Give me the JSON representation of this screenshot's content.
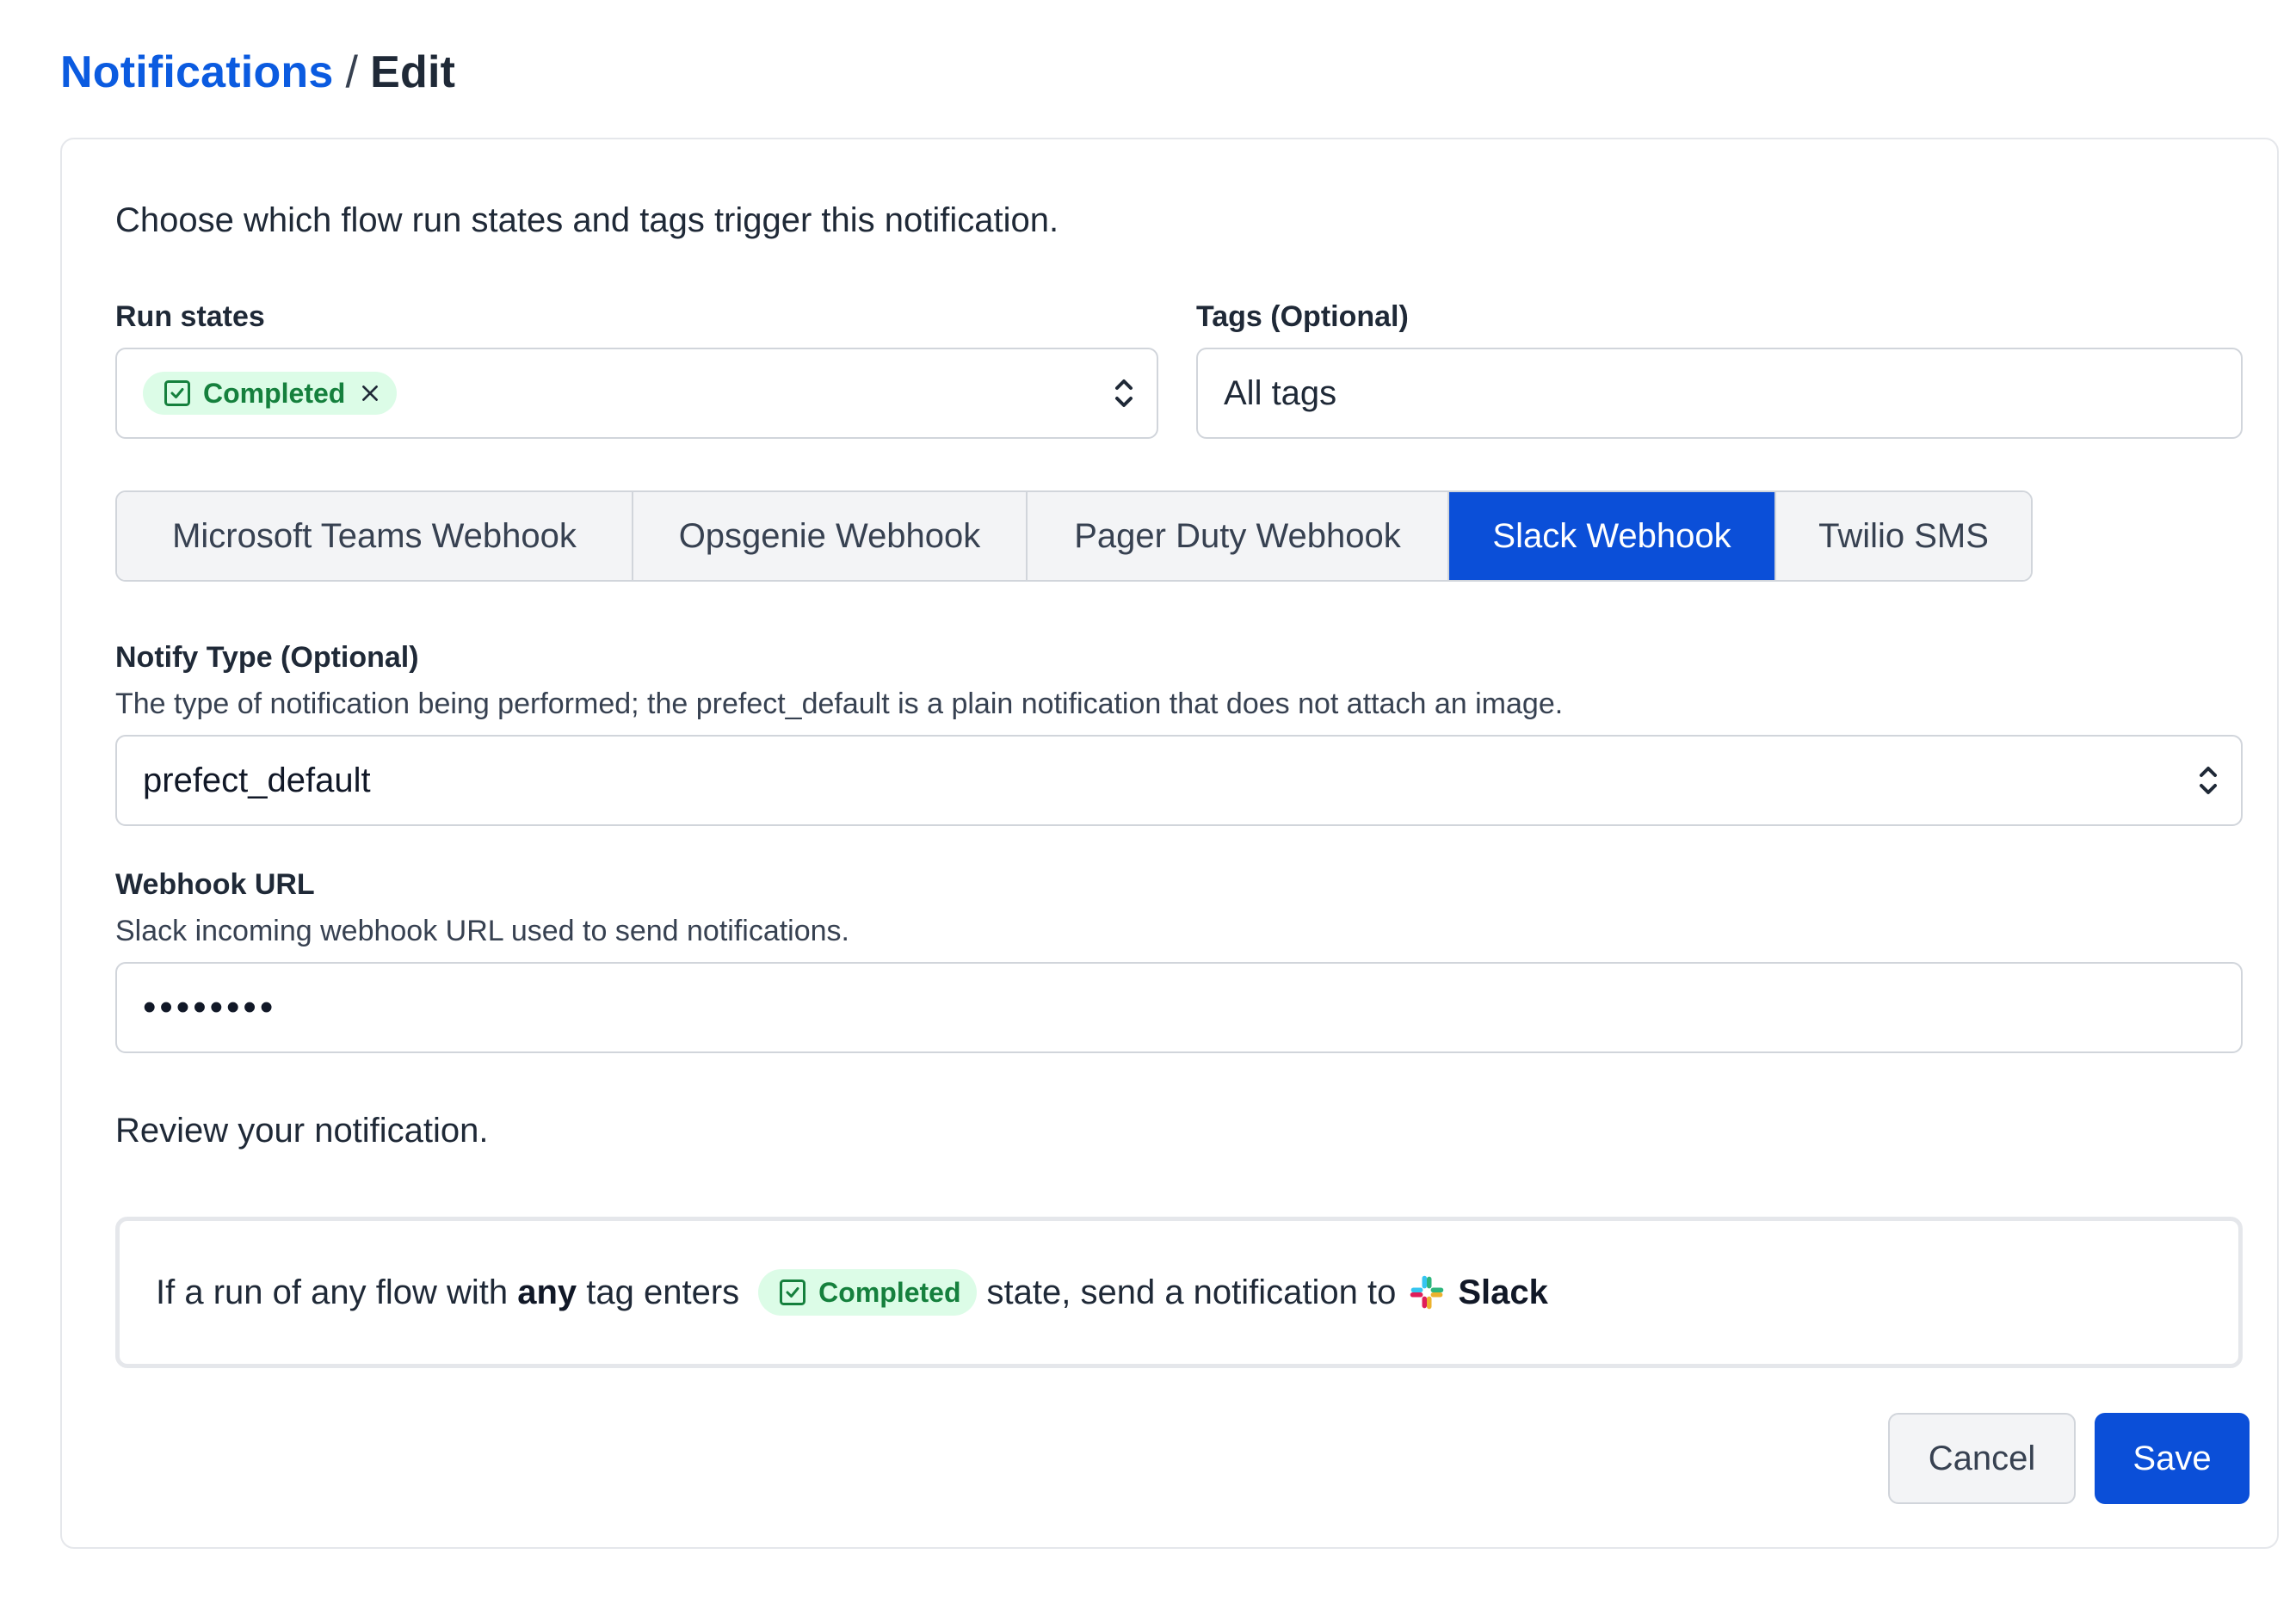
{
  "breadcrumb": {
    "parent": "Notifications",
    "separator": "/",
    "current": "Edit"
  },
  "form": {
    "intro": "Choose which flow run states and tags trigger this notification.",
    "run_states": {
      "label": "Run states",
      "selected": [
        "Completed"
      ]
    },
    "tags": {
      "label": "Tags (Optional)",
      "placeholder": "All tags"
    },
    "tabs": [
      {
        "label": "Microsoft Teams Webhook",
        "active": false
      },
      {
        "label": "Opsgenie Webhook",
        "active": false
      },
      {
        "label": "Pager Duty Webhook",
        "active": false
      },
      {
        "label": "Slack Webhook",
        "active": true
      },
      {
        "label": "Twilio SMS",
        "active": false
      }
    ],
    "notify_type": {
      "label": "Notify Type (Optional)",
      "description": "The type of notification being performed; the prefect_default is a plain notification that does not attach an image.",
      "value": "prefect_default"
    },
    "webhook_url": {
      "label": "Webhook URL",
      "description": "Slack incoming webhook URL used to send notifications.",
      "value": "••••••••"
    },
    "review": {
      "heading": "Review your notification.",
      "prefix": "If a run of any flow with",
      "bold_any": "any",
      "mid": "tag enters",
      "state": "Completed",
      "suffix": "state, send a notification to",
      "target": "Slack"
    },
    "buttons": {
      "cancel": "Cancel",
      "save": "Save"
    }
  },
  "colors": {
    "primary": "#0b4fd8",
    "link": "#0b5be0",
    "completed_bg": "#dcfce7",
    "completed_fg": "#15803d"
  },
  "icons": {
    "state_icon": "check-square-icon",
    "remove_icon": "close-icon",
    "select_icon": "chevron-up-down-icon",
    "target_icon": "slack-logo-icon"
  }
}
